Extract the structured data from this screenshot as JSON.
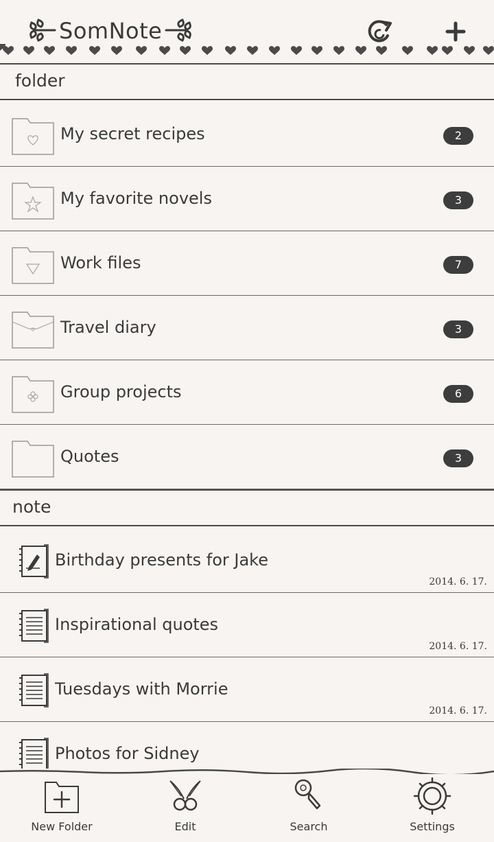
{
  "app": {
    "title": "SomNote"
  },
  "folder_section": {
    "title": "folder"
  },
  "folders": [
    {
      "name": "My secret recipes",
      "count": "2",
      "icon": "folder-heart-icon"
    },
    {
      "name": "My favorite novels",
      "count": "3",
      "icon": "folder-star-icon"
    },
    {
      "name": "Work files",
      "count": "7",
      "icon": "folder-triangle-icon"
    },
    {
      "name": "Travel diary",
      "count": "3",
      "icon": "envelope-folder-icon"
    },
    {
      "name": "Group projects",
      "count": "6",
      "icon": "folder-flower-icon"
    },
    {
      "name": "Quotes",
      "count": "3",
      "icon": "folder-icon"
    }
  ],
  "note_section": {
    "title": "note"
  },
  "notes": [
    {
      "title": "Birthday presents for Jake",
      "date": "2014. 6. 17.",
      "icon": "notebook-icon"
    },
    {
      "title": "Inspirational quotes",
      "date": "2014. 6. 17.",
      "icon": "notebook-icon"
    },
    {
      "title": "Tuesdays with Morrie",
      "date": "2014. 6. 17.",
      "icon": "notebook-icon"
    },
    {
      "title": "Photos for Sidney",
      "date": "",
      "icon": "notebook-icon"
    }
  ],
  "tabbar": {
    "new_folder": "New Folder",
    "edit": "Edit",
    "search": "Search",
    "settings": "Settings"
  }
}
